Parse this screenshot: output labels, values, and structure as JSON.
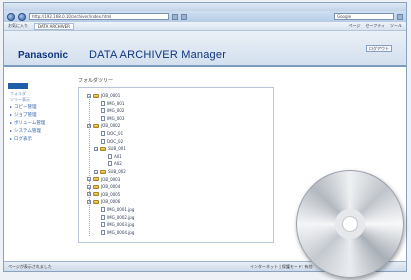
{
  "browser": {
    "address": "http://192.168.0.10/archiver/index.html",
    "search_placeholder": "Google",
    "tab_label": "DATA ARCHIVER",
    "favorites_label": "お気に入り",
    "commands": [
      "ページ",
      "セーフティ",
      "ツール"
    ]
  },
  "app": {
    "brand": "Panasonic",
    "title": "DATA ARCHIVER Manager",
    "header_button": "ログアウト",
    "page_heading": "フォルダツリー"
  },
  "sidebar": {
    "active_label": "",
    "sub_items": [
      "フォルダ",
      "ツリー表示"
    ],
    "links": [
      "コピー管理",
      "ジョブ管理",
      "ボリューム管理",
      "システム管理",
      "ログ表示"
    ]
  },
  "tree": [
    {
      "label": "JOB_0001",
      "indent": 0,
      "kind": "folder"
    },
    {
      "label": "IMG_001",
      "indent": 2,
      "kind": "file"
    },
    {
      "label": "IMG_002",
      "indent": 2,
      "kind": "file"
    },
    {
      "label": "IMG_003",
      "indent": 2,
      "kind": "file"
    },
    {
      "label": "JOB_0002",
      "indent": 0,
      "kind": "folder"
    },
    {
      "label": "DOC_01",
      "indent": 2,
      "kind": "file"
    },
    {
      "label": "DOC_02",
      "indent": 2,
      "kind": "file"
    },
    {
      "label": "SUB_001",
      "indent": 1,
      "kind": "folder"
    },
    {
      "label": "A01",
      "indent": 3,
      "kind": "file"
    },
    {
      "label": "A02",
      "indent": 3,
      "kind": "file"
    },
    {
      "label": "SUB_002",
      "indent": 1,
      "kind": "folder"
    },
    {
      "label": "JOB_0003",
      "indent": 0,
      "kind": "folder"
    },
    {
      "label": "JOB_0004",
      "indent": 0,
      "kind": "folder"
    },
    {
      "label": "JOB_0005",
      "indent": 0,
      "kind": "folder"
    },
    {
      "label": "JOB_0006",
      "indent": 0,
      "kind": "folder"
    },
    {
      "label": "IMG_0001.jpg",
      "indent": 2,
      "kind": "file"
    },
    {
      "label": "IMG_0002.jpg",
      "indent": 2,
      "kind": "file"
    },
    {
      "label": "IMG_0003.jpg",
      "indent": 2,
      "kind": "file"
    },
    {
      "label": "IMG_0004.jpg",
      "indent": 2,
      "kind": "file"
    }
  ],
  "status": {
    "left": "ページが表示されました",
    "zone": "インターネット | 保護モード: 有効",
    "zoom": "100%"
  }
}
